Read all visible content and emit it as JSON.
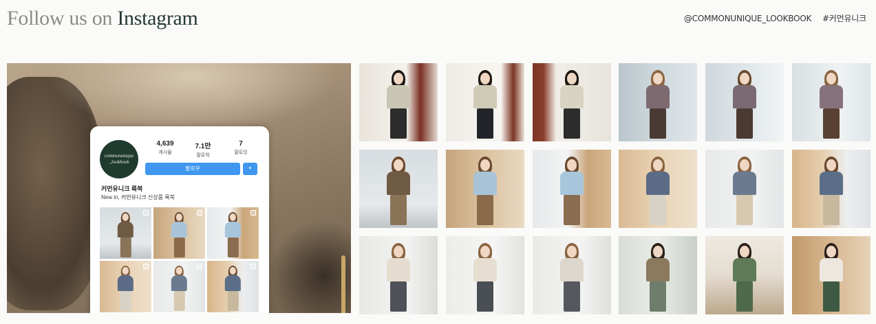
{
  "header": {
    "title_prefix": "Follow us on",
    "title_brand": "Instagram",
    "handle": "@COMMONUNIQUE_LOOKBOOK",
    "hashtag": "#커먼유니크"
  },
  "profile_card": {
    "avatar_text_1": "commonunique",
    "avatar_text_2": "_lookbook",
    "stats": [
      {
        "value": "4,639",
        "label": "게시물"
      },
      {
        "value": "7.1만",
        "label": "팔로워"
      },
      {
        "value": "7",
        "label": "팔로잉"
      }
    ],
    "follow_label": "팔로우",
    "dropdown_icon": "▾",
    "name": "커먼유니크 룩북",
    "bio": "New in, 커먼유니크 신상품 룩북"
  },
  "colors": {
    "title_gray": "#8a8a86",
    "title_green": "#23392f",
    "follow_blue": "#3f97f0"
  }
}
